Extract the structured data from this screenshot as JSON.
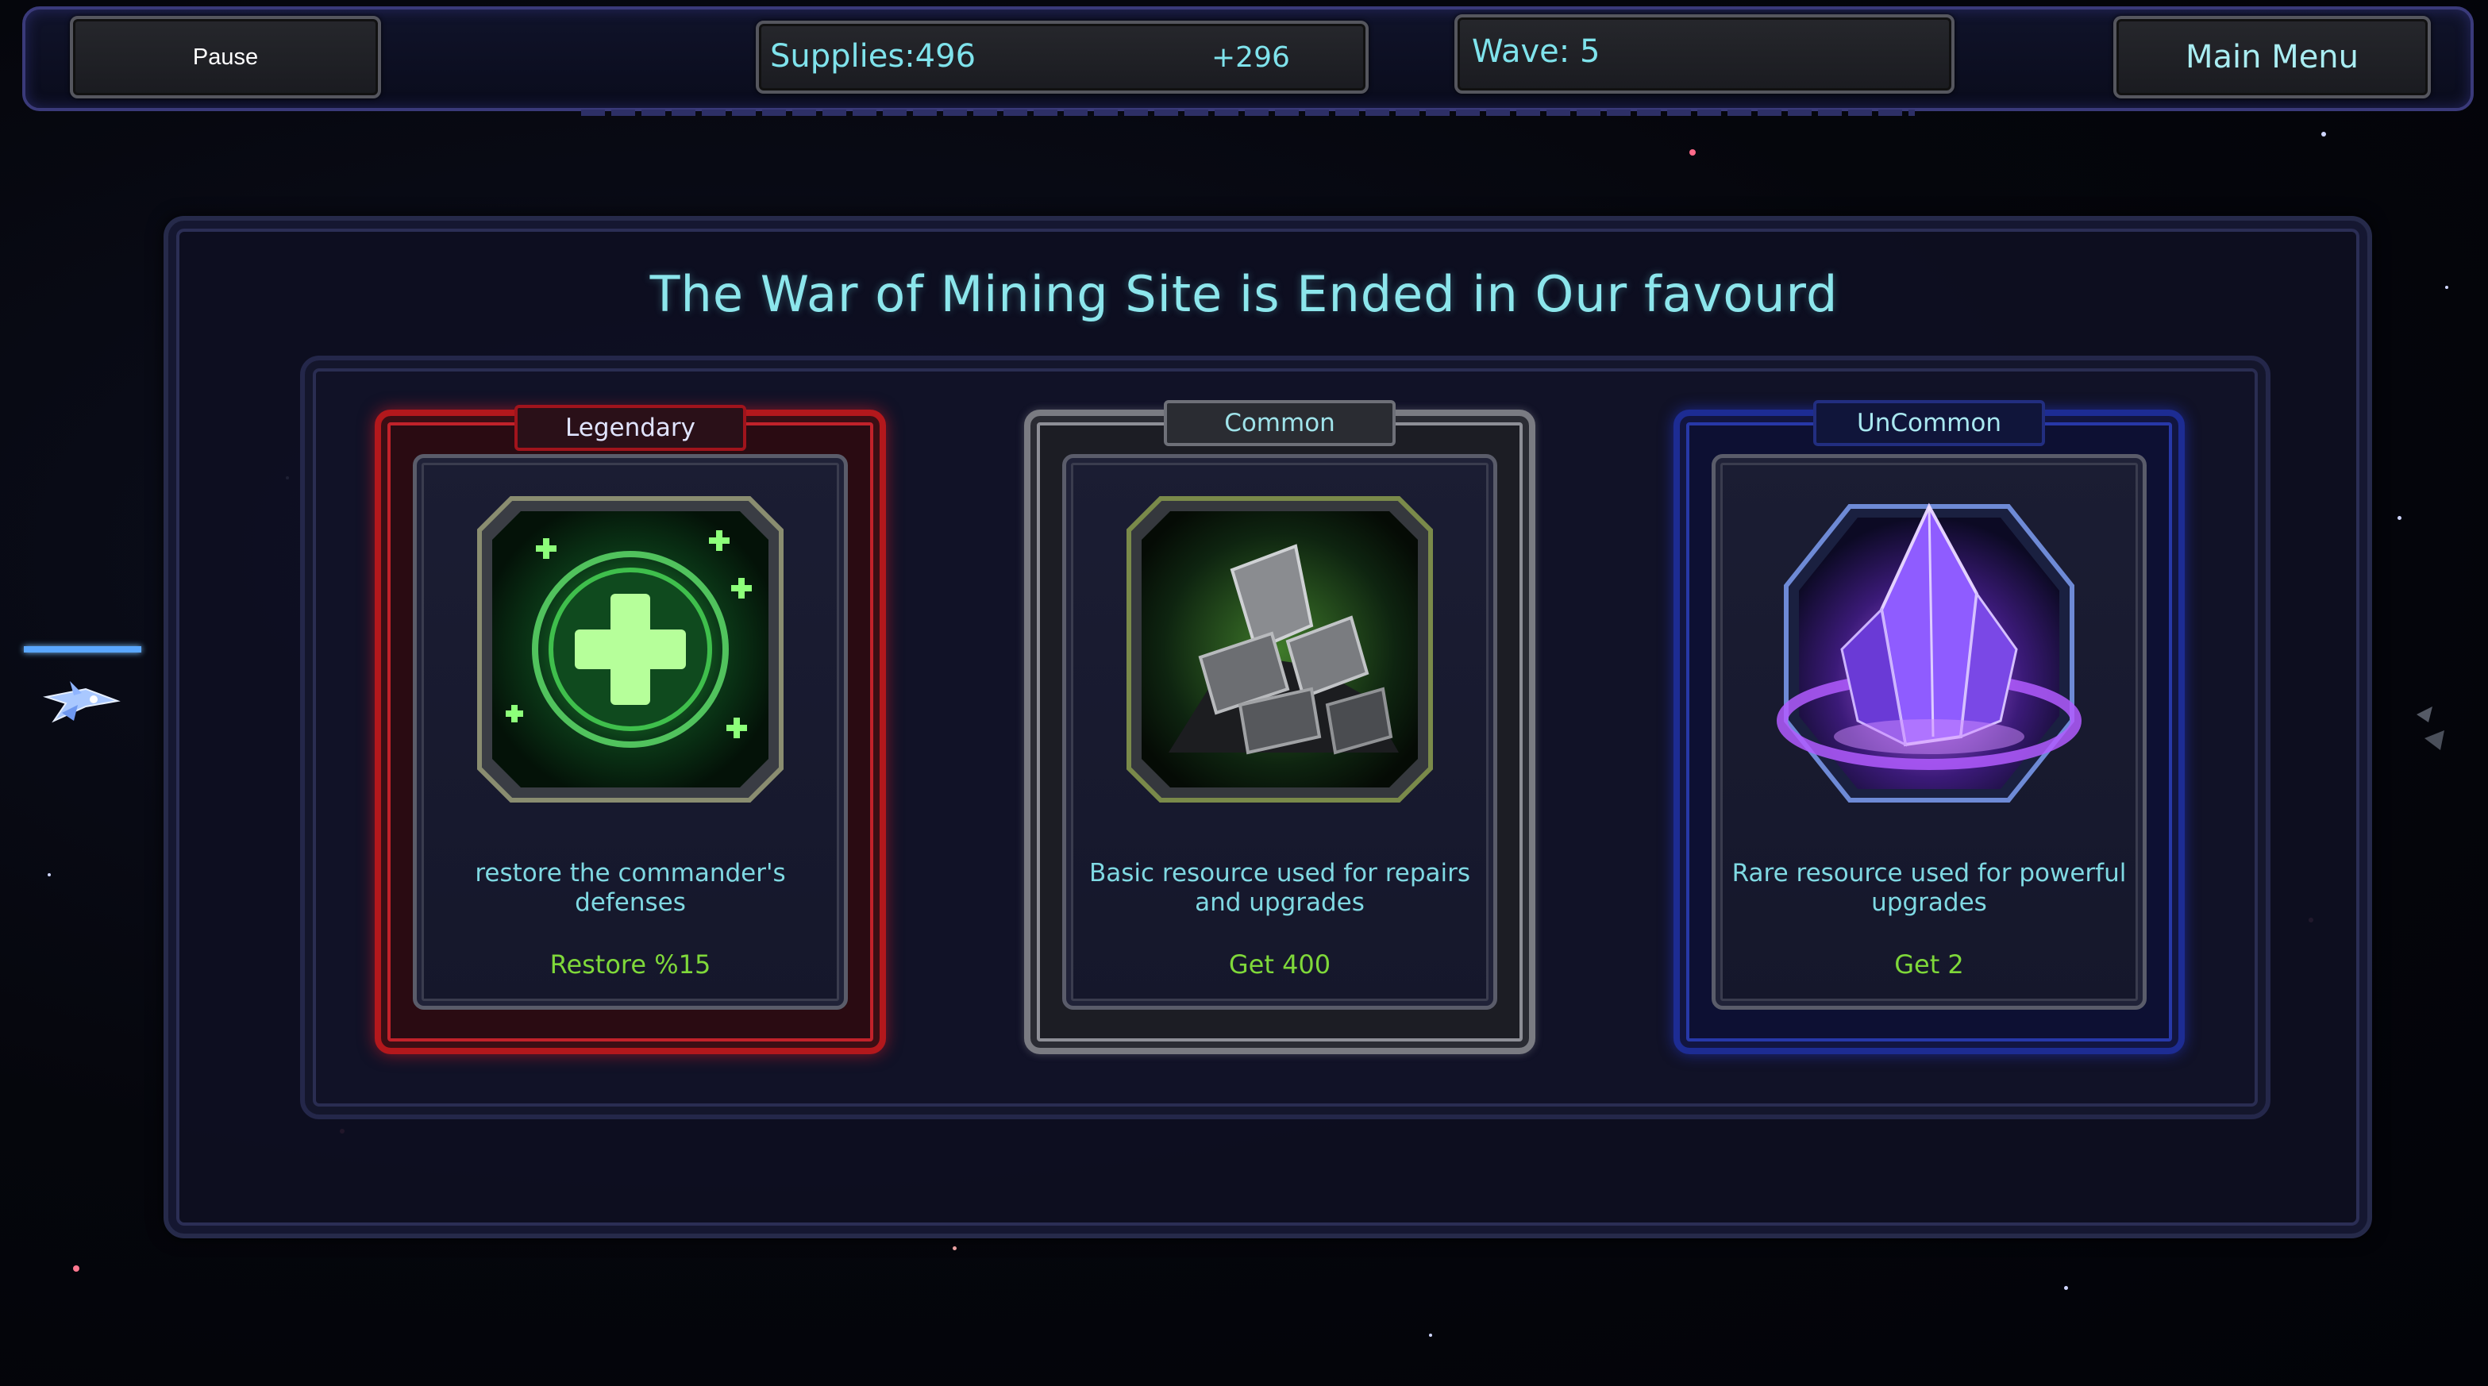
{
  "topbar": {
    "pause_label": "Pause",
    "supplies_label": "Supplies:496",
    "supplies_delta": "+296",
    "wave_label": "Wave: 5",
    "main_menu_label": "Main Menu"
  },
  "title": "The War of Mining Site is Ended in Our favourd",
  "cards": [
    {
      "rarity": "Legendary",
      "icon": "medical-cross-icon",
      "description": "restore the commander's defenses",
      "value": "Restore %15",
      "accent": "#c1222a"
    },
    {
      "rarity": "Common",
      "icon": "metal-ore-icon",
      "description": "Basic resource used for repairs and upgrades",
      "value": "Get 400",
      "accent": "#8d8e96"
    },
    {
      "rarity": "UnCommon",
      "icon": "purple-crystal-icon",
      "description": "Rare resource used for powerful upgrades",
      "value": "Get  2",
      "accent": "#2738a8"
    }
  ],
  "colors": {
    "text_cyan": "#7fe3ec",
    "value_green": "#7fd83a"
  }
}
